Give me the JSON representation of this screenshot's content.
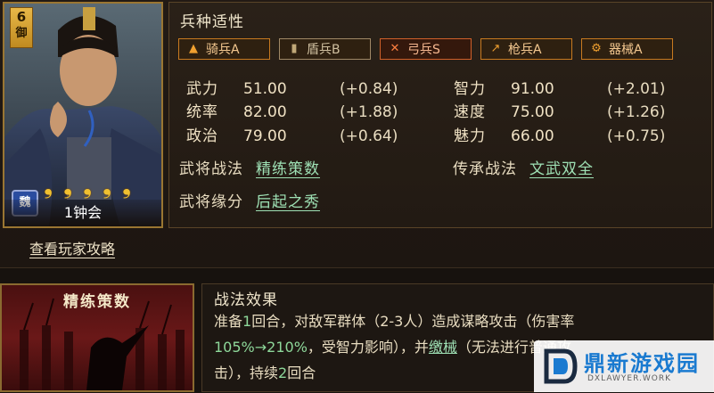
{
  "hero": {
    "level": "6",
    "class_tag": "御",
    "faction": "魏",
    "stars": [
      "❟",
      "❟",
      "❟",
      "❟",
      "❟"
    ],
    "name": "1钟会",
    "guide_link": "查看玩家攻略"
  },
  "troops": {
    "title": "兵种适性",
    "items": [
      {
        "icon": "horse-icon",
        "glyph": "▲",
        "label": "骑兵A"
      },
      {
        "icon": "shield-icon",
        "glyph": "▮",
        "label": "盾兵B"
      },
      {
        "icon": "bow-icon",
        "glyph": "✕",
        "label": "弓兵S"
      },
      {
        "icon": "spear-icon",
        "glyph": "↗",
        "label": "枪兵A"
      },
      {
        "icon": "siege-icon",
        "glyph": "⚙",
        "label": "器械A"
      }
    ]
  },
  "stats": [
    {
      "label": "武力",
      "value": "51.00",
      "bonus": "(+0.84)"
    },
    {
      "label": "统率",
      "value": "82.00",
      "bonus": "(+1.88)"
    },
    {
      "label": "政治",
      "value": "79.00",
      "bonus": "(+0.64)"
    },
    {
      "label": "智力",
      "value": "91.00",
      "bonus": "(+2.01)"
    },
    {
      "label": "速度",
      "value": "75.00",
      "bonus": "(+1.26)"
    },
    {
      "label": "魅力",
      "value": "66.00",
      "bonus": "(+0.75)"
    }
  ],
  "skills": {
    "general_label": "武将战法",
    "general_value": "精练策数",
    "inherit_label": "传承战法",
    "inherit_value": "文武双全",
    "fate_label": "武将缘分",
    "fate_value": "后起之秀"
  },
  "tactic": {
    "card_title": "精练策数",
    "effect_title": "战法效果",
    "line1_a": "准备",
    "line1_num": "1",
    "line1_b": "回合，对敌军群体（2-3人）造成谋略攻击（伤害率",
    "line2_range": "105%→210%",
    "line2_b": "，受智力影响），并",
    "line2_link": "缴械",
    "line2_c": "（无法进行普通攻",
    "line3_a": "击），持续",
    "line3_num": "2",
    "line3_b": "回合"
  },
  "watermark": {
    "name": "鼎新游戏园",
    "sub": "DXLAWYER.WORK"
  }
}
